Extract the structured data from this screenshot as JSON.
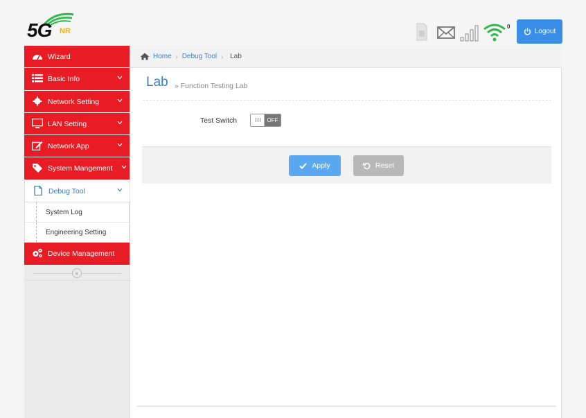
{
  "header": {
    "logo_text": "5G",
    "logo_sub": "NR",
    "logout_label": "Logout",
    "wifi_count": "0",
    "icons": [
      "sim-icon",
      "mail-icon",
      "signal-icon",
      "wifi-icon"
    ]
  },
  "sidebar": {
    "items": [
      {
        "label": "Wizard",
        "icon": "dashboard-icon"
      },
      {
        "label": "Basic Info",
        "icon": "list-icon"
      },
      {
        "label": "Network Setting",
        "icon": "gear-icon"
      },
      {
        "label": "LAN Setting",
        "icon": "monitor-icon"
      },
      {
        "label": "Network App",
        "icon": "edit-icon"
      },
      {
        "label": "System Mangement",
        "icon": "tag-icon"
      },
      {
        "label": "Debug Tool",
        "icon": "document-icon"
      },
      {
        "label": "Device Management",
        "icon": "gears-icon"
      }
    ],
    "sub_items": [
      "System Log",
      "Engineering Setting"
    ],
    "collapse_glyph": "«"
  },
  "breadcrumb": {
    "home": "Home",
    "parent": "Debug Tool",
    "current": "Lab",
    "sep": "›"
  },
  "page": {
    "title": "Lab",
    "subtitle": "» Function Testing Lab"
  },
  "form": {
    "test_switch_label": "Test Switch",
    "switch_state": "OFF"
  },
  "buttons": {
    "apply": "Apply",
    "reset": "Reset"
  },
  "colors": {
    "accent_red": "#e81c24",
    "link_blue": "#3a7ec1",
    "apply_blue": "#5aa9f0",
    "logout_blue": "#3a8ee6",
    "reset_gray": "#b8b8b8",
    "wifi_green": "#2fb84b"
  }
}
